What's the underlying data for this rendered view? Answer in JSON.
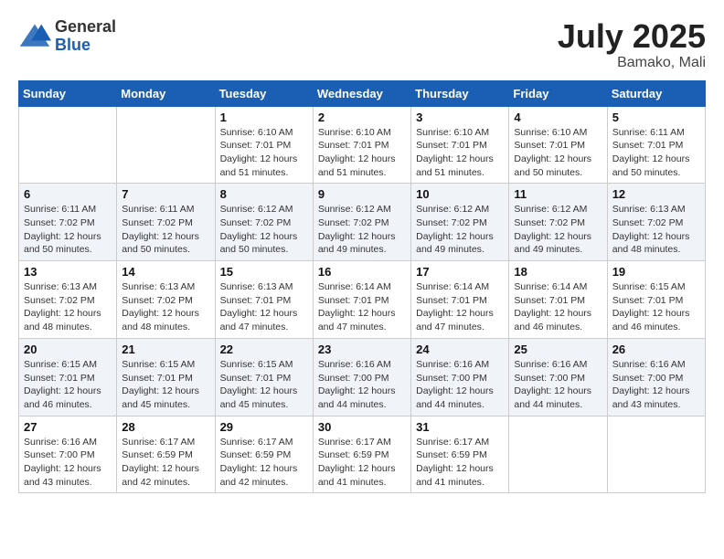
{
  "header": {
    "logo_general": "General",
    "logo_blue": "Blue",
    "month_title": "July 2025",
    "location": "Bamako, Mali"
  },
  "calendar": {
    "days_of_week": [
      "Sunday",
      "Monday",
      "Tuesday",
      "Wednesday",
      "Thursday",
      "Friday",
      "Saturday"
    ],
    "weeks": [
      [
        {
          "day": "",
          "info": ""
        },
        {
          "day": "",
          "info": ""
        },
        {
          "day": "1",
          "info": "Sunrise: 6:10 AM\nSunset: 7:01 PM\nDaylight: 12 hours and 51 minutes."
        },
        {
          "day": "2",
          "info": "Sunrise: 6:10 AM\nSunset: 7:01 PM\nDaylight: 12 hours and 51 minutes."
        },
        {
          "day": "3",
          "info": "Sunrise: 6:10 AM\nSunset: 7:01 PM\nDaylight: 12 hours and 51 minutes."
        },
        {
          "day": "4",
          "info": "Sunrise: 6:10 AM\nSunset: 7:01 PM\nDaylight: 12 hours and 50 minutes."
        },
        {
          "day": "5",
          "info": "Sunrise: 6:11 AM\nSunset: 7:01 PM\nDaylight: 12 hours and 50 minutes."
        }
      ],
      [
        {
          "day": "6",
          "info": "Sunrise: 6:11 AM\nSunset: 7:02 PM\nDaylight: 12 hours and 50 minutes."
        },
        {
          "day": "7",
          "info": "Sunrise: 6:11 AM\nSunset: 7:02 PM\nDaylight: 12 hours and 50 minutes."
        },
        {
          "day": "8",
          "info": "Sunrise: 6:12 AM\nSunset: 7:02 PM\nDaylight: 12 hours and 50 minutes."
        },
        {
          "day": "9",
          "info": "Sunrise: 6:12 AM\nSunset: 7:02 PM\nDaylight: 12 hours and 49 minutes."
        },
        {
          "day": "10",
          "info": "Sunrise: 6:12 AM\nSunset: 7:02 PM\nDaylight: 12 hours and 49 minutes."
        },
        {
          "day": "11",
          "info": "Sunrise: 6:12 AM\nSunset: 7:02 PM\nDaylight: 12 hours and 49 minutes."
        },
        {
          "day": "12",
          "info": "Sunrise: 6:13 AM\nSunset: 7:02 PM\nDaylight: 12 hours and 48 minutes."
        }
      ],
      [
        {
          "day": "13",
          "info": "Sunrise: 6:13 AM\nSunset: 7:02 PM\nDaylight: 12 hours and 48 minutes."
        },
        {
          "day": "14",
          "info": "Sunrise: 6:13 AM\nSunset: 7:02 PM\nDaylight: 12 hours and 48 minutes."
        },
        {
          "day": "15",
          "info": "Sunrise: 6:13 AM\nSunset: 7:01 PM\nDaylight: 12 hours and 47 minutes."
        },
        {
          "day": "16",
          "info": "Sunrise: 6:14 AM\nSunset: 7:01 PM\nDaylight: 12 hours and 47 minutes."
        },
        {
          "day": "17",
          "info": "Sunrise: 6:14 AM\nSunset: 7:01 PM\nDaylight: 12 hours and 47 minutes."
        },
        {
          "day": "18",
          "info": "Sunrise: 6:14 AM\nSunset: 7:01 PM\nDaylight: 12 hours and 46 minutes."
        },
        {
          "day": "19",
          "info": "Sunrise: 6:15 AM\nSunset: 7:01 PM\nDaylight: 12 hours and 46 minutes."
        }
      ],
      [
        {
          "day": "20",
          "info": "Sunrise: 6:15 AM\nSunset: 7:01 PM\nDaylight: 12 hours and 46 minutes."
        },
        {
          "day": "21",
          "info": "Sunrise: 6:15 AM\nSunset: 7:01 PM\nDaylight: 12 hours and 45 minutes."
        },
        {
          "day": "22",
          "info": "Sunrise: 6:15 AM\nSunset: 7:01 PM\nDaylight: 12 hours and 45 minutes."
        },
        {
          "day": "23",
          "info": "Sunrise: 6:16 AM\nSunset: 7:00 PM\nDaylight: 12 hours and 44 minutes."
        },
        {
          "day": "24",
          "info": "Sunrise: 6:16 AM\nSunset: 7:00 PM\nDaylight: 12 hours and 44 minutes."
        },
        {
          "day": "25",
          "info": "Sunrise: 6:16 AM\nSunset: 7:00 PM\nDaylight: 12 hours and 44 minutes."
        },
        {
          "day": "26",
          "info": "Sunrise: 6:16 AM\nSunset: 7:00 PM\nDaylight: 12 hours and 43 minutes."
        }
      ],
      [
        {
          "day": "27",
          "info": "Sunrise: 6:16 AM\nSunset: 7:00 PM\nDaylight: 12 hours and 43 minutes."
        },
        {
          "day": "28",
          "info": "Sunrise: 6:17 AM\nSunset: 6:59 PM\nDaylight: 12 hours and 42 minutes."
        },
        {
          "day": "29",
          "info": "Sunrise: 6:17 AM\nSunset: 6:59 PM\nDaylight: 12 hours and 42 minutes."
        },
        {
          "day": "30",
          "info": "Sunrise: 6:17 AM\nSunset: 6:59 PM\nDaylight: 12 hours and 41 minutes."
        },
        {
          "day": "31",
          "info": "Sunrise: 6:17 AM\nSunset: 6:59 PM\nDaylight: 12 hours and 41 minutes."
        },
        {
          "day": "",
          "info": ""
        },
        {
          "day": "",
          "info": ""
        }
      ]
    ]
  }
}
